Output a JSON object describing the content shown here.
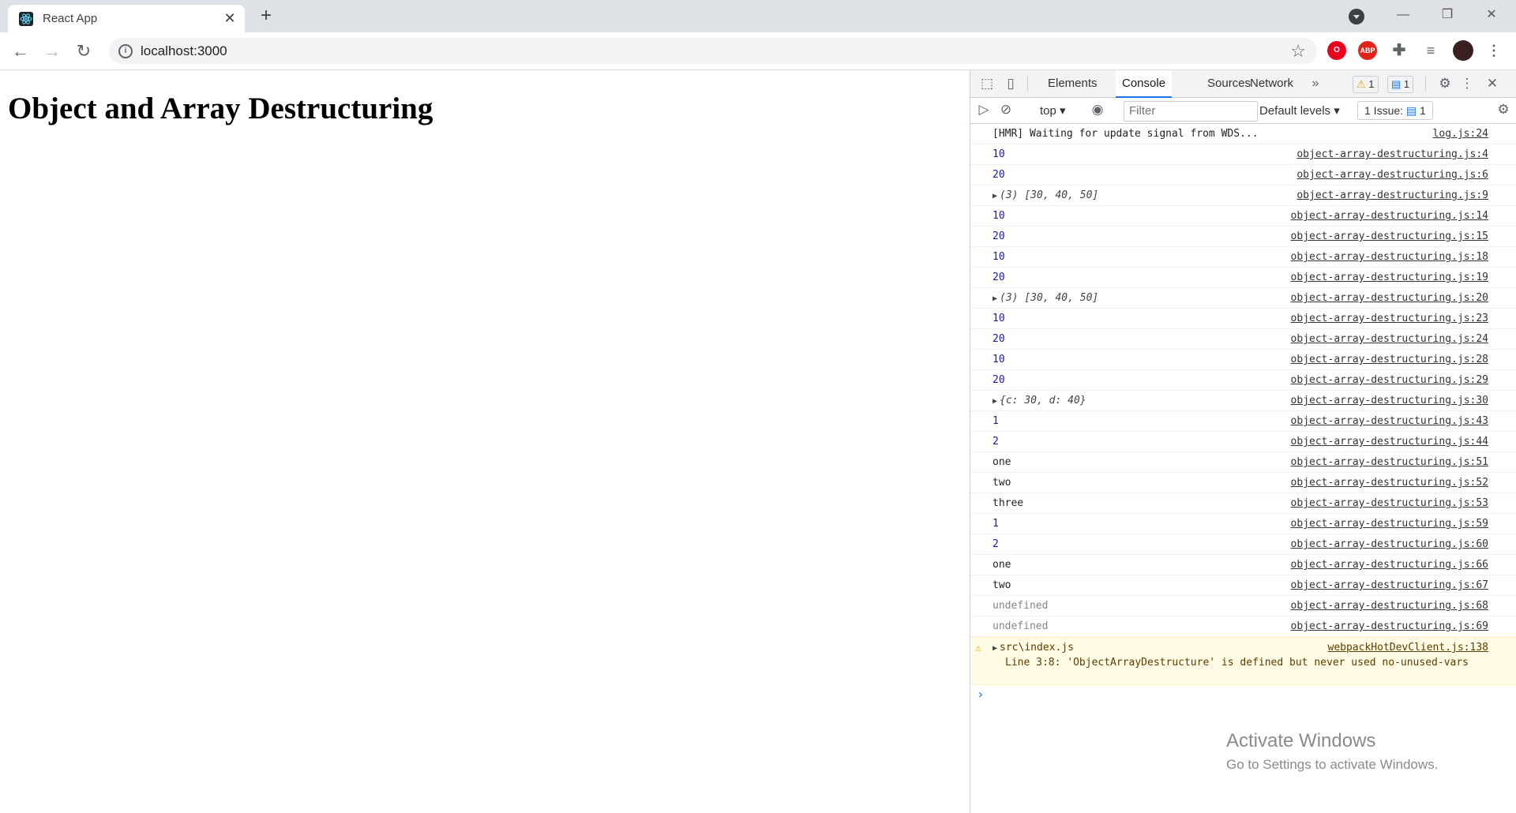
{
  "browser": {
    "tab_title": "React App",
    "tab_close": "✕",
    "new_tab": "+",
    "url": "localhost:3000",
    "window_controls": [
      "—",
      "❐",
      "✕"
    ]
  },
  "extensions": [
    {
      "name": "opera-icon",
      "label": "O",
      "color": "#e8001c"
    },
    {
      "name": "adblock-plus-icon",
      "label": "ABP",
      "color": "#e2231a"
    }
  ],
  "page": {
    "heading": "Object and Array Destructuring"
  },
  "devtools": {
    "tabs": [
      "Elements",
      "Console",
      "Sources",
      "Network"
    ],
    "active_tab": "Console",
    "warning_count": "1",
    "message_count": "1",
    "context": "top",
    "filter_placeholder": "Filter",
    "levels": "Default levels",
    "issues": "1 Issue:",
    "issues_count": "1"
  },
  "console": {
    "rows": [
      {
        "text": "[HMR] Waiting for update signal from WDS...",
        "kind": "str",
        "src": "log.js:24"
      },
      {
        "text": "10",
        "kind": "num",
        "src": "object-array-destructuring.js:4"
      },
      {
        "text": "20",
        "kind": "num",
        "src": "object-array-destructuring.js:6"
      },
      {
        "text": "(3) [30, 40, 50]",
        "kind": "obj",
        "src": "object-array-destructuring.js:9"
      },
      {
        "text": "10",
        "kind": "num",
        "src": "object-array-destructuring.js:14"
      },
      {
        "text": "20",
        "kind": "num",
        "src": "object-array-destructuring.js:15"
      },
      {
        "text": "10",
        "kind": "num",
        "src": "object-array-destructuring.js:18"
      },
      {
        "text": "20",
        "kind": "num",
        "src": "object-array-destructuring.js:19"
      },
      {
        "text": "(3) [30, 40, 50]",
        "kind": "obj",
        "src": "object-array-destructuring.js:20"
      },
      {
        "text": "10",
        "kind": "num",
        "src": "object-array-destructuring.js:23"
      },
      {
        "text": "20",
        "kind": "num",
        "src": "object-array-destructuring.js:24"
      },
      {
        "text": "10",
        "kind": "num",
        "src": "object-array-destructuring.js:28"
      },
      {
        "text": "20",
        "kind": "num",
        "src": "object-array-destructuring.js:29"
      },
      {
        "text": "{c: 30, d: 40}",
        "kind": "obj",
        "src": "object-array-destructuring.js:30"
      },
      {
        "text": "1",
        "kind": "num",
        "src": "object-array-destructuring.js:43"
      },
      {
        "text": "2",
        "kind": "num",
        "src": "object-array-destructuring.js:44"
      },
      {
        "text": "one",
        "kind": "str",
        "src": "object-array-destructuring.js:51"
      },
      {
        "text": "two",
        "kind": "str",
        "src": "object-array-destructuring.js:52"
      },
      {
        "text": "three",
        "kind": "str",
        "src": "object-array-destructuring.js:53"
      },
      {
        "text": "1",
        "kind": "num",
        "src": "object-array-destructuring.js:59"
      },
      {
        "text": "2",
        "kind": "num",
        "src": "object-array-destructuring.js:60"
      },
      {
        "text": "one",
        "kind": "str",
        "src": "object-array-destructuring.js:66"
      },
      {
        "text": "two",
        "kind": "str",
        "src": "object-array-destructuring.js:67"
      },
      {
        "text": "undefined",
        "kind": "undef",
        "src": "object-array-destructuring.js:68"
      },
      {
        "text": "undefined",
        "kind": "undef",
        "src": "object-array-destructuring.js:69"
      }
    ],
    "warning": {
      "head": "src\\index.js",
      "src": "webpackHotDevClient.js:138",
      "body": "Line 3:8:  'ObjectArrayDestructure' is defined but never used  no-unused-vars"
    },
    "prompt": "›"
  },
  "watermark": {
    "title": "Activate Windows",
    "subtitle": "Go to Settings to activate Windows."
  }
}
